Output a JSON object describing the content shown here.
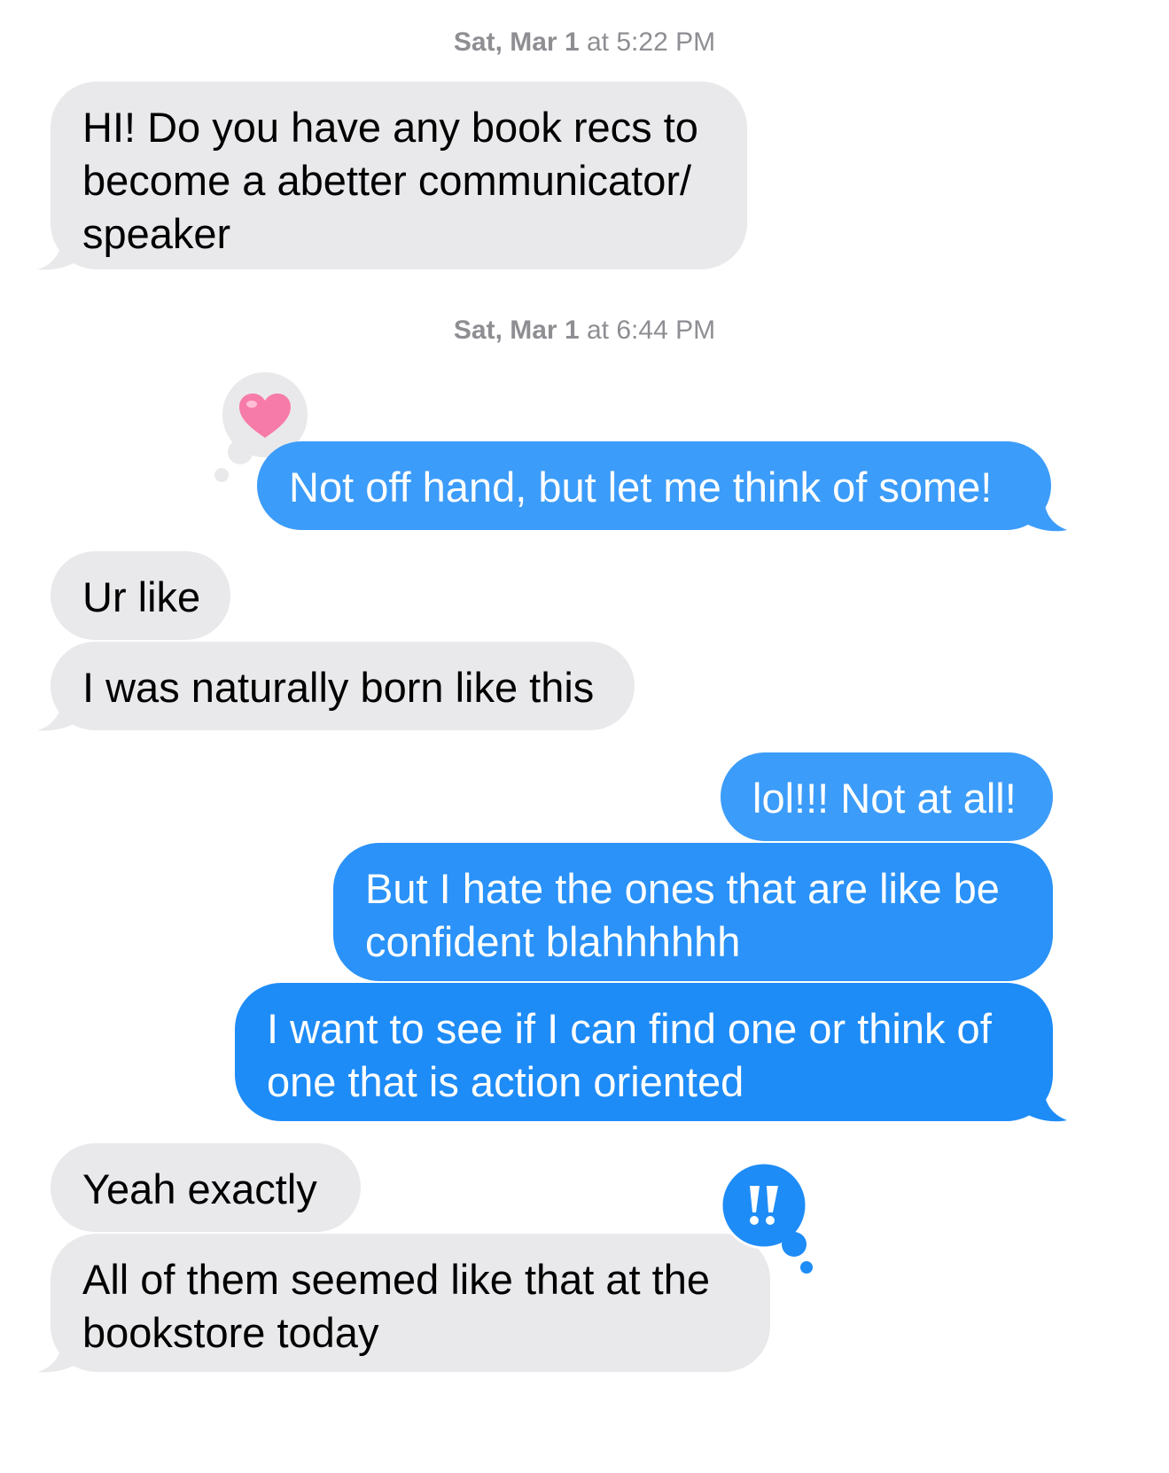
{
  "conversation": {
    "timestamp_1": {
      "day": "Sat, Mar 1",
      "at": "at",
      "time": "5:22 PM"
    },
    "timestamp_2": {
      "day": "Sat, Mar 1",
      "at": "at",
      "time": "6:44 PM"
    },
    "messages": [
      {
        "sender": "them",
        "lines": [
          "HI! Do you have any book recs to",
          "become a abetter communicator/",
          "speaker"
        ]
      },
      {
        "sender": "me",
        "text": "Not off hand, but let me think of some!",
        "tapback": "heart-icon"
      },
      {
        "sender": "them",
        "text": "Ur like"
      },
      {
        "sender": "them",
        "text": "I was naturally born like this"
      },
      {
        "sender": "me",
        "text": "lol!!! Not at all!"
      },
      {
        "sender": "me",
        "lines": [
          "But I hate the ones that are like be",
          "confident blahhhhhh"
        ]
      },
      {
        "sender": "me",
        "lines": [
          "I want to see if I can find one or think of",
          "one that is action oriented"
        ]
      },
      {
        "sender": "them",
        "text": "Yeah exactly"
      },
      {
        "sender": "them",
        "lines": [
          "All of them seemed like that at the",
          "bookstore today"
        ],
        "tapback": "exclamation-icon"
      }
    ]
  },
  "colors": {
    "incoming_bubble": "#e9e9eb",
    "outgoing_bubble": "#1e8cf7",
    "heart": "#f77ba8",
    "timestamp": "#8e8e93"
  }
}
